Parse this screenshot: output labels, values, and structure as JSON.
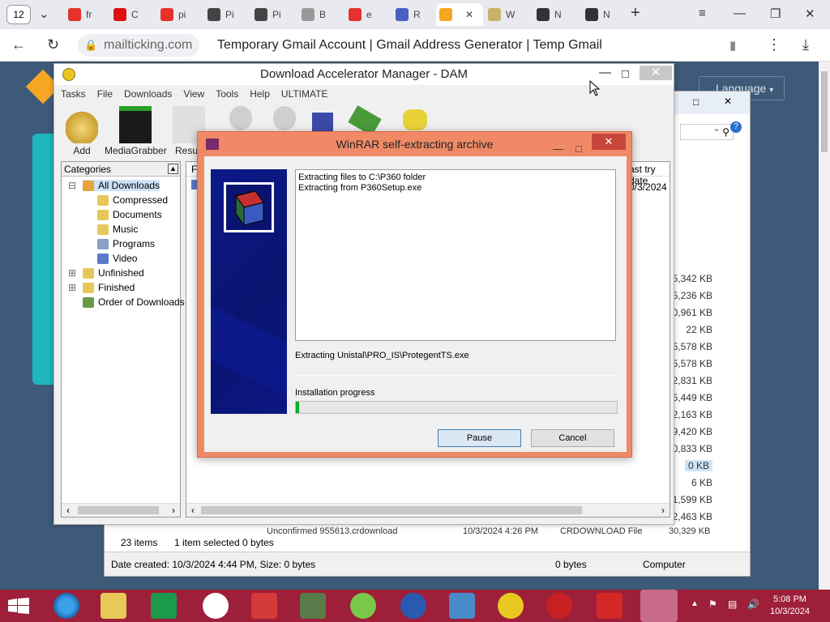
{
  "browser": {
    "tab_count": "12",
    "tabs": [
      {
        "label": "fr",
        "color": "#e5322d"
      },
      {
        "label": "C",
        "color": "#d11"
      },
      {
        "label": "pi",
        "color": "#e5322d"
      },
      {
        "label": "Pi",
        "color": "#444"
      },
      {
        "label": "Pi",
        "color": "#444"
      },
      {
        "label": "B",
        "color": "#999"
      },
      {
        "label": "e",
        "color": "#e5322d"
      },
      {
        "label": "R",
        "color": "#4a5fc1"
      },
      {
        "label": "",
        "color": "#f5a623"
      },
      {
        "label": "W",
        "color": "#c7b36a"
      },
      {
        "label": "N",
        "color": "#333"
      },
      {
        "label": "N",
        "color": "#333"
      }
    ],
    "address_domain": "mailticking.com",
    "page_title": "Temporary Gmail Account | Gmail Address Generator | Temp Gmail"
  },
  "webpage": {
    "language_button": "Language"
  },
  "dam": {
    "title": "Download Accelerator Manager - DAM",
    "menu": [
      "Tasks",
      "File",
      "Downloads",
      "View",
      "Tools",
      "Help",
      "ULTIMATE"
    ],
    "toolbar": [
      {
        "label": "Add",
        "icon": "add-icon"
      },
      {
        "label": "MediaGrabber",
        "icon": "media-grabber-icon"
      },
      {
        "label": "Resu",
        "icon": "resume-icon"
      }
    ],
    "categories_header": "Categories",
    "categories": [
      {
        "label": "All Downloads",
        "color": "#e8a33a"
      },
      {
        "label": "Compressed",
        "color": "#e6c85a"
      },
      {
        "label": "Documents",
        "color": "#e6c85a"
      },
      {
        "label": "Music",
        "color": "#e6c85a"
      },
      {
        "label": "Programs",
        "color": "#8aa0c8"
      },
      {
        "label": "Video",
        "color": "#5a7ac8"
      },
      {
        "label": "Unfinished",
        "color": "#e6c85a"
      },
      {
        "label": "Finished",
        "color": "#e6c85a"
      },
      {
        "label": "Order of Downloads",
        "color": "#6a9a4a"
      }
    ],
    "list_header": {
      "col_f": "F",
      "col_last_try": "ast try date"
    },
    "list_date": "0/3/2024"
  },
  "winrar": {
    "title": "WinRAR self-extracting archive",
    "log_lines": [
      "Extracting files to C:\\P360 folder",
      "Extracting from P360Setup.exe"
    ],
    "current_file": "Extracting Unistal\\PRO_IS\\ProtegentTS.exe",
    "progress_label": "Installation progress",
    "progress_fraction": 0.01,
    "pause_button": "Pause",
    "cancel_button": "Cancel"
  },
  "explorer": {
    "sizes": [
      "5,342 KB",
      "5,236 KB",
      "0,961 KB",
      "22 KB",
      "5,578 KB",
      "5,578 KB",
      "2,831 KB",
      "5,449 KB",
      "2,163 KB",
      "9,420 KB",
      "0,833 KB",
      "0 KB",
      "6 KB",
      "1,599 KB",
      "2,463 KB"
    ],
    "partial_row": {
      "name": "Unconfirmed 955613.crdownload",
      "date": "10/3/2024 4:26 PM",
      "type": "CRDOWNLOAD File",
      "size": "30,329 KB"
    },
    "items_count": "23 items",
    "selected": "1 item selected  0 bytes",
    "status_left": "Date created: 10/3/2024 4:44 PM, Size: 0 bytes",
    "status_mid": "0 bytes",
    "status_right": "Computer"
  },
  "taskbar": {
    "time": "5:08 PM",
    "date": "10/3/2024"
  }
}
